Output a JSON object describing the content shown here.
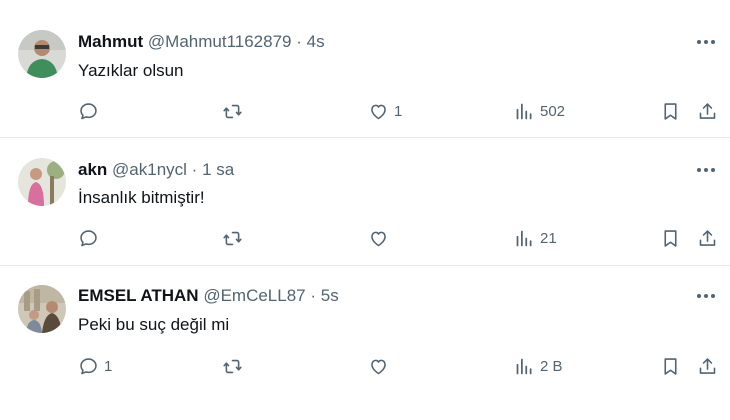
{
  "tweets": [
    {
      "name": "Mahmut",
      "handle": "@Mahmut1162879",
      "separator": "·",
      "time": "4s",
      "text": "Yazıklar olsun",
      "replies": "",
      "retweets": "",
      "likes": "1",
      "views": "502"
    },
    {
      "name": "akn",
      "handle": "@ak1nycl",
      "separator": "·",
      "time": "1 sa",
      "text": "İnsanlık bitmiştir!",
      "replies": "",
      "retweets": "",
      "likes": "",
      "views": "21"
    },
    {
      "name": "EMSEL ATHAN",
      "handle": "@EmCeLL87",
      "separator": "·",
      "time": "5s",
      "text": "Peki bu suç değil mi",
      "replies": "1",
      "retweets": "",
      "likes": "",
      "views": "2 B"
    }
  ],
  "colors": {
    "primary_text": "#0f1419",
    "secondary_text": "#536471",
    "divider": "#e7e9ea",
    "background": "#ffffff"
  },
  "icons": [
    "reply-icon",
    "retweet-icon",
    "like-icon",
    "views-icon",
    "bookmark-icon",
    "share-icon",
    "more-icon"
  ]
}
